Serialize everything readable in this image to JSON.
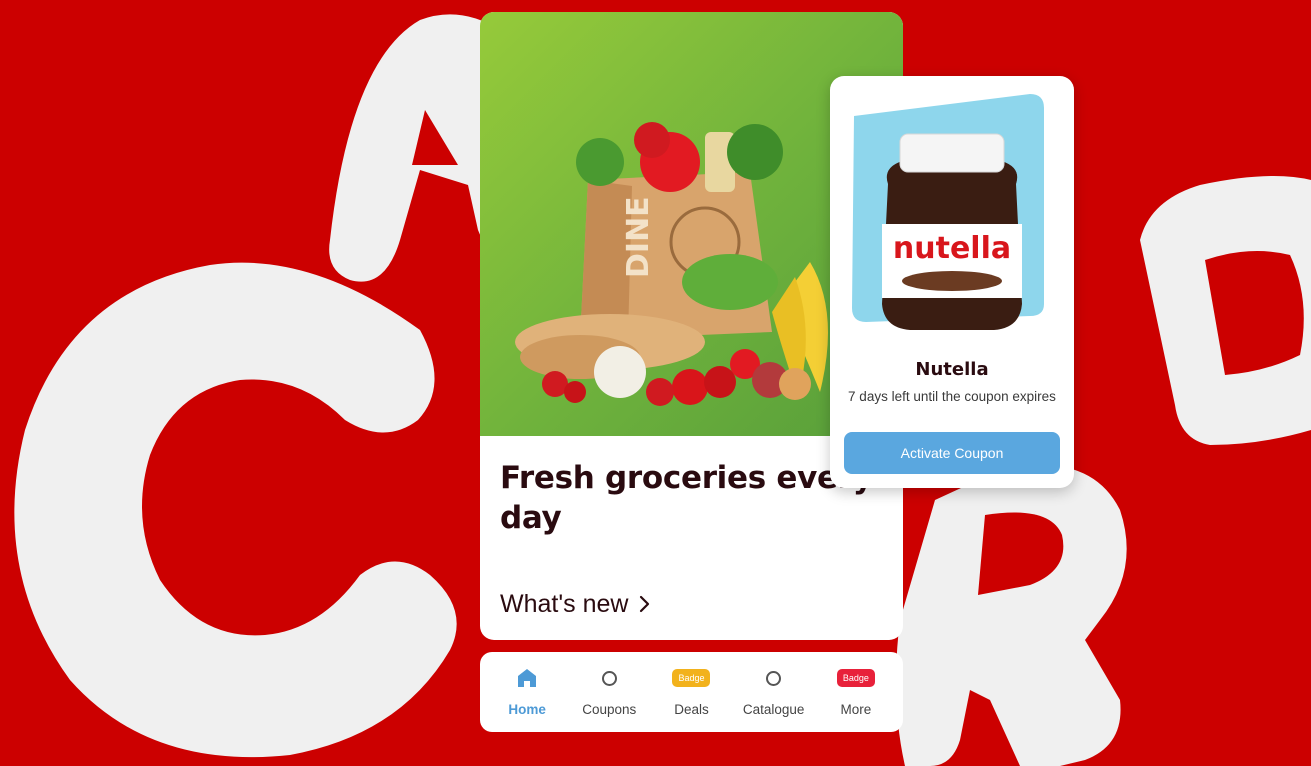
{
  "colors": {
    "background": "#cc0000",
    "letters": "#f0f0f0",
    "accent_blue": "#5aa7df",
    "badge_yellow": "#f2b21c",
    "badge_red": "#e8213a",
    "title_text": "#2a0b10"
  },
  "promo": {
    "title": "Fresh groceries every day",
    "link_label": "What's new",
    "link_icon": "chevron-right-icon",
    "image": "grocery-bag-image",
    "bag_label": "DINE"
  },
  "coupon": {
    "product_name": "Nutella",
    "expiry_text": "7 days left until the coupon expires",
    "button_label": "Activate Coupon",
    "image": "nutella-jar-image",
    "brand_label": "nutella"
  },
  "nav": {
    "items": [
      {
        "label": "Home",
        "icon": "home-icon",
        "active": true
      },
      {
        "label": "Coupons",
        "icon": "circle-icon",
        "active": false
      },
      {
        "label": "Deals",
        "icon": "badge",
        "badge": "Badge",
        "active": false
      },
      {
        "label": "Catalogue",
        "icon": "circle-icon",
        "active": false
      },
      {
        "label": "More",
        "icon": "badge",
        "badge": "Badge",
        "active": false
      }
    ]
  }
}
